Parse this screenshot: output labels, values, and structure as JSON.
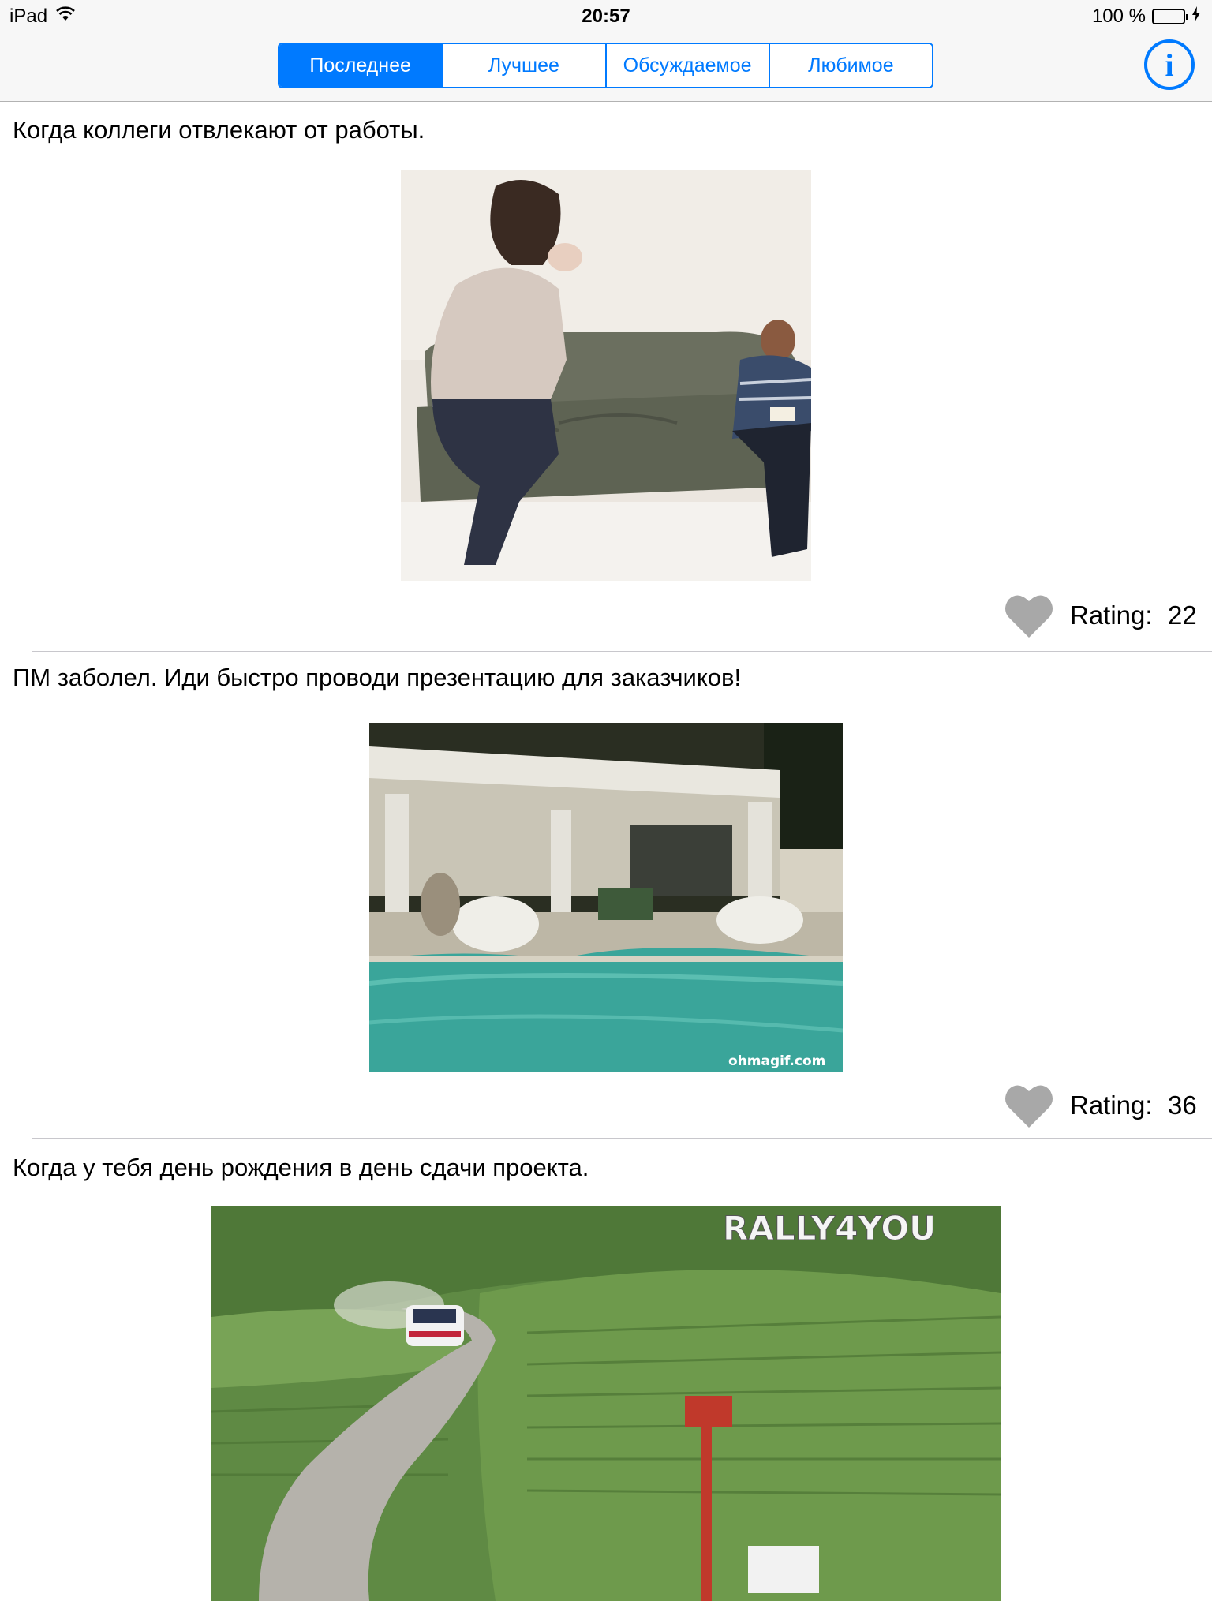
{
  "status_bar": {
    "device": "iPad",
    "time": "20:57",
    "battery_text": "100 %"
  },
  "nav": {
    "tabs": [
      {
        "label": "Последнее",
        "active": true
      },
      {
        "label": "Лучшее",
        "active": false
      },
      {
        "label": "Обсуждаемое",
        "active": false
      },
      {
        "label": "Любимое",
        "active": false
      }
    ],
    "info_glyph": "i"
  },
  "posts": [
    {
      "title": "Когда коллеги отвлекают от работы.",
      "rating_label": "Rating:",
      "rating": "22",
      "image": "woman jumping on couch next to reading man"
    },
    {
      "title": "ПМ заболел. Иди быстро проводи презентацию для заказчиков!",
      "rating_label": "Rating:",
      "rating": "36",
      "image": "poolside villa patio",
      "watermark": "ohmagif.com"
    },
    {
      "title": "Когда у тебя день рождения в день сдачи проекта.",
      "image": "rally car on vineyard road",
      "watermark": "RALLY4YOU"
    }
  ],
  "colors": {
    "accent": "#007aff",
    "battery": "#4cd964",
    "heart": "#a8a8a8",
    "separator": "#c8c7cc"
  }
}
